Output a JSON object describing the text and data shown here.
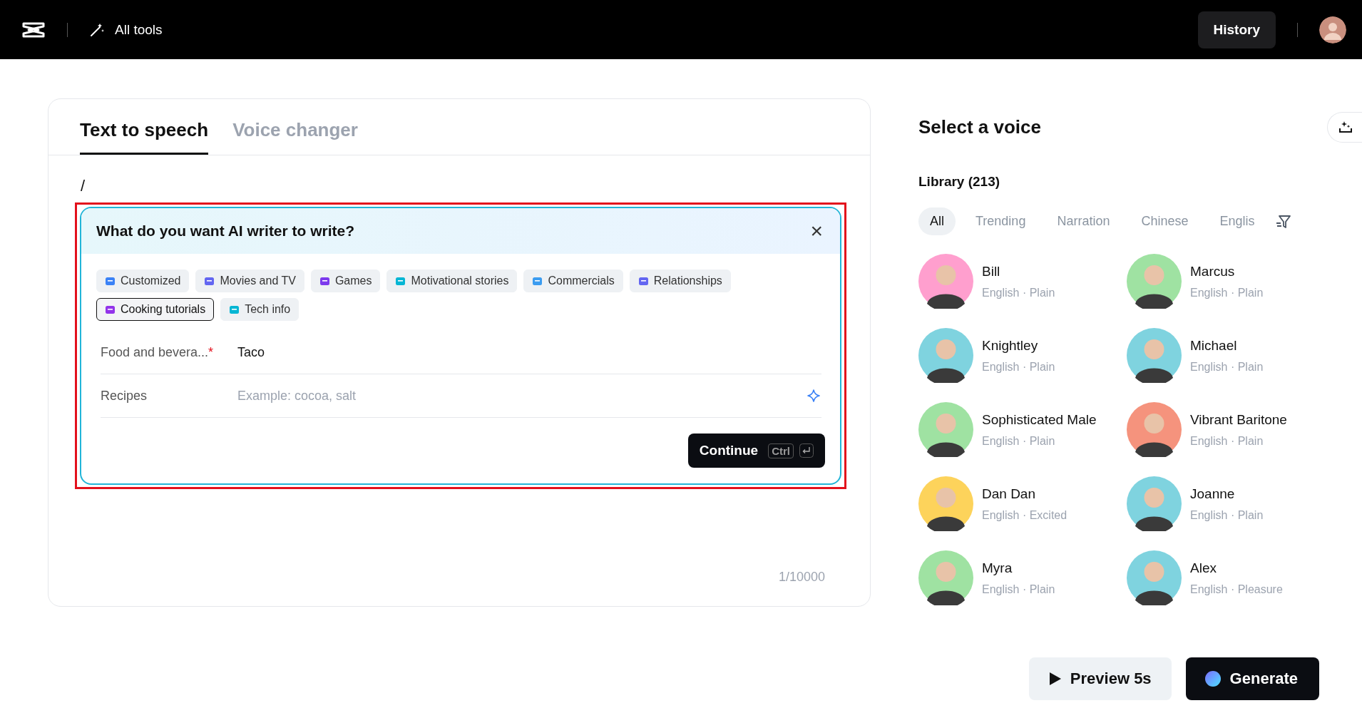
{
  "topbar": {
    "all_tools": "All tools",
    "history": "History"
  },
  "editor": {
    "tabs": [
      {
        "label": "Text to speech",
        "selected": true
      },
      {
        "label": "Voice changer",
        "selected": false
      }
    ],
    "text": "/",
    "counter": "1/10000",
    "ai_writer": {
      "title": "What do you want AI writer to write?",
      "close": "×",
      "chips": [
        {
          "label": "Customized",
          "selected": false
        },
        {
          "label": "Movies and TV",
          "selected": false
        },
        {
          "label": "Games",
          "selected": false
        },
        {
          "label": "Motivational stories",
          "selected": false
        },
        {
          "label": "Commercials",
          "selected": false
        },
        {
          "label": "Relationships",
          "selected": false
        },
        {
          "label": "Cooking tutorials",
          "selected": true
        },
        {
          "label": "Tech info",
          "selected": false
        }
      ],
      "fields": [
        {
          "kind": "plain",
          "label": "Food and bevera...",
          "required_mark": "*",
          "value": "Taco"
        },
        {
          "kind": "assist",
          "label": "Recipes",
          "placeholder": "Example: cocoa, salt"
        }
      ],
      "continue": {
        "label": "Continue",
        "key": "Ctrl"
      }
    }
  },
  "voices": {
    "title": "Select a voice",
    "library": "Library (213)",
    "filters": [
      {
        "label": "All",
        "selected": true
      },
      {
        "label": "Trending",
        "selected": false
      },
      {
        "label": "Narration",
        "selected": false
      },
      {
        "label": "Chinese",
        "selected": false
      },
      {
        "label": "Englis",
        "selected": false
      }
    ],
    "items": [
      {
        "name": "Bill",
        "desc": "English · Plain",
        "color": "#ff9fce"
      },
      {
        "name": "Marcus",
        "desc": "English · Plain",
        "color": "#9fe2a2"
      },
      {
        "name": "Knightley",
        "desc": "English · Plain",
        "color": "#7fd3df"
      },
      {
        "name": "Michael",
        "desc": "English · Plain",
        "color": "#7fd3df"
      },
      {
        "name": "Sophisticated Male",
        "desc": "English · Plain",
        "color": "#9fe2a2"
      },
      {
        "name": "Vibrant Baritone",
        "desc": "English · Plain",
        "color": "#f5937d"
      },
      {
        "name": "Dan Dan",
        "desc": "English · Excited",
        "color": "#fdd35b"
      },
      {
        "name": "Joanne",
        "desc": "English · Plain",
        "color": "#7fd3df"
      },
      {
        "name": "Myra",
        "desc": "English · Plain",
        "color": "#9fe2a2"
      },
      {
        "name": "Alex",
        "desc": "English · Pleasure",
        "color": "#7fd3df"
      }
    ]
  },
  "actions": {
    "preview": "Preview 5s",
    "generate": "Generate"
  }
}
